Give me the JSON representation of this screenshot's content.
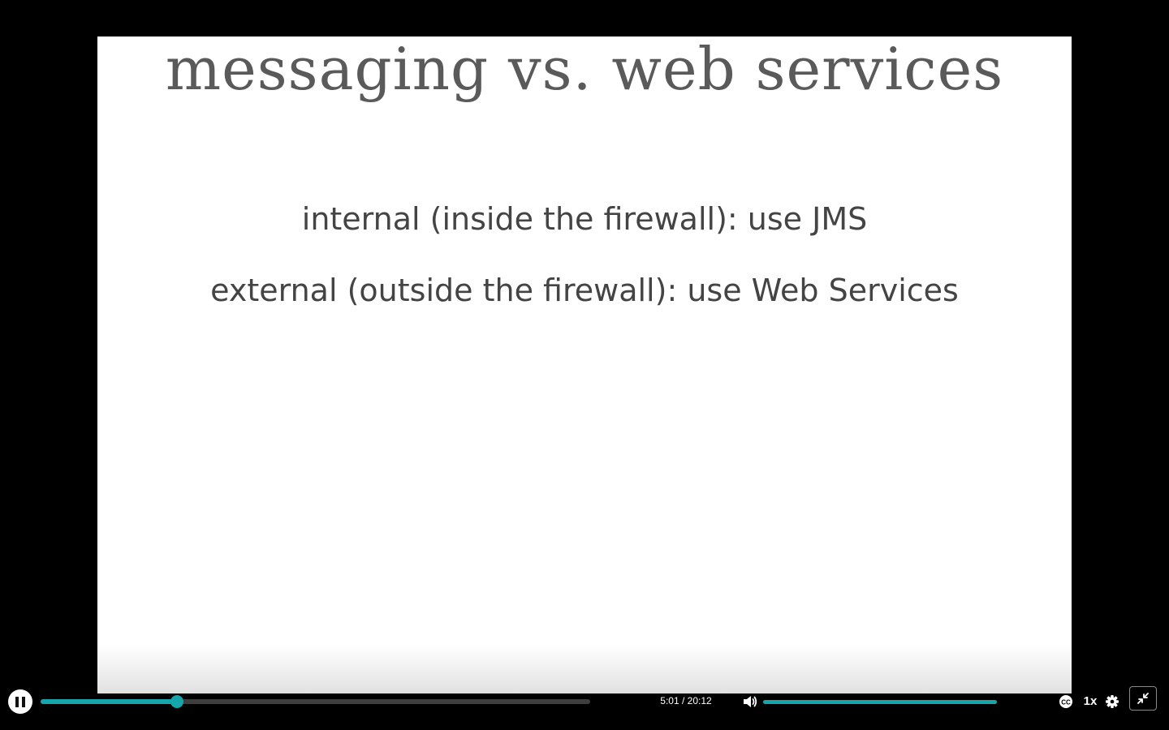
{
  "slide": {
    "title": "messaging vs. web services",
    "bullets": [
      "internal (inside the firewall): use JMS",
      "external (outside the firewall): use Web Services"
    ]
  },
  "player": {
    "current_time": "5:01",
    "time_separator": "/",
    "duration": "20:12",
    "time_display": "5:01 / 20:12",
    "progress_fraction": 0.2483,
    "volume_fraction": 1.0,
    "speed_label": "1x",
    "state": "playing",
    "accent_color": "#14a6aa",
    "icons": {
      "play_pause": "pause-icon",
      "volume": "volume-icon",
      "captions": "closed-captions-icon",
      "settings": "gear-icon",
      "fullscreen": "exit-fullscreen-icon"
    }
  }
}
